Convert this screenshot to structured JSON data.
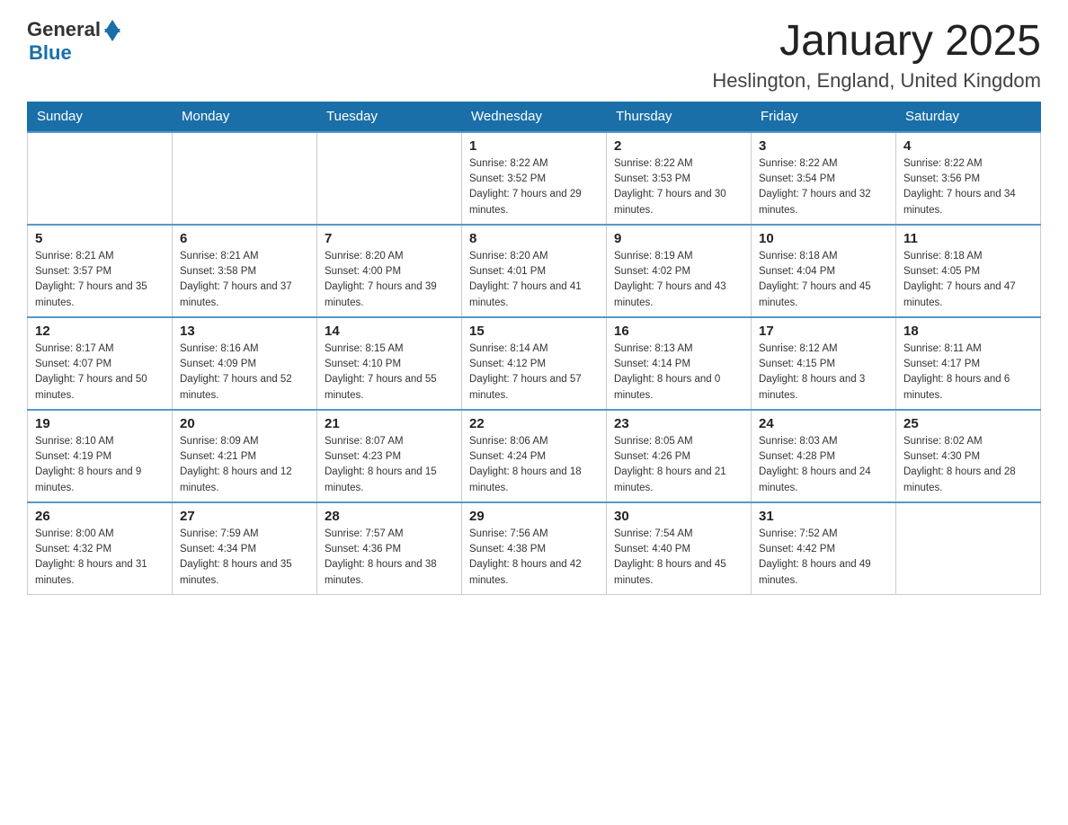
{
  "header": {
    "logo_general": "General",
    "logo_blue": "Blue",
    "month_title": "January 2025",
    "location": "Heslington, England, United Kingdom"
  },
  "days_of_week": [
    "Sunday",
    "Monday",
    "Tuesday",
    "Wednesday",
    "Thursday",
    "Friday",
    "Saturday"
  ],
  "weeks": [
    [
      {
        "day": "",
        "sunrise": "",
        "sunset": "",
        "daylight": ""
      },
      {
        "day": "",
        "sunrise": "",
        "sunset": "",
        "daylight": ""
      },
      {
        "day": "",
        "sunrise": "",
        "sunset": "",
        "daylight": ""
      },
      {
        "day": "1",
        "sunrise": "Sunrise: 8:22 AM",
        "sunset": "Sunset: 3:52 PM",
        "daylight": "Daylight: 7 hours and 29 minutes."
      },
      {
        "day": "2",
        "sunrise": "Sunrise: 8:22 AM",
        "sunset": "Sunset: 3:53 PM",
        "daylight": "Daylight: 7 hours and 30 minutes."
      },
      {
        "day": "3",
        "sunrise": "Sunrise: 8:22 AM",
        "sunset": "Sunset: 3:54 PM",
        "daylight": "Daylight: 7 hours and 32 minutes."
      },
      {
        "day": "4",
        "sunrise": "Sunrise: 8:22 AM",
        "sunset": "Sunset: 3:56 PM",
        "daylight": "Daylight: 7 hours and 34 minutes."
      }
    ],
    [
      {
        "day": "5",
        "sunrise": "Sunrise: 8:21 AM",
        "sunset": "Sunset: 3:57 PM",
        "daylight": "Daylight: 7 hours and 35 minutes."
      },
      {
        "day": "6",
        "sunrise": "Sunrise: 8:21 AM",
        "sunset": "Sunset: 3:58 PM",
        "daylight": "Daylight: 7 hours and 37 minutes."
      },
      {
        "day": "7",
        "sunrise": "Sunrise: 8:20 AM",
        "sunset": "Sunset: 4:00 PM",
        "daylight": "Daylight: 7 hours and 39 minutes."
      },
      {
        "day": "8",
        "sunrise": "Sunrise: 8:20 AM",
        "sunset": "Sunset: 4:01 PM",
        "daylight": "Daylight: 7 hours and 41 minutes."
      },
      {
        "day": "9",
        "sunrise": "Sunrise: 8:19 AM",
        "sunset": "Sunset: 4:02 PM",
        "daylight": "Daylight: 7 hours and 43 minutes."
      },
      {
        "day": "10",
        "sunrise": "Sunrise: 8:18 AM",
        "sunset": "Sunset: 4:04 PM",
        "daylight": "Daylight: 7 hours and 45 minutes."
      },
      {
        "day": "11",
        "sunrise": "Sunrise: 8:18 AM",
        "sunset": "Sunset: 4:05 PM",
        "daylight": "Daylight: 7 hours and 47 minutes."
      }
    ],
    [
      {
        "day": "12",
        "sunrise": "Sunrise: 8:17 AM",
        "sunset": "Sunset: 4:07 PM",
        "daylight": "Daylight: 7 hours and 50 minutes."
      },
      {
        "day": "13",
        "sunrise": "Sunrise: 8:16 AM",
        "sunset": "Sunset: 4:09 PM",
        "daylight": "Daylight: 7 hours and 52 minutes."
      },
      {
        "day": "14",
        "sunrise": "Sunrise: 8:15 AM",
        "sunset": "Sunset: 4:10 PM",
        "daylight": "Daylight: 7 hours and 55 minutes."
      },
      {
        "day": "15",
        "sunrise": "Sunrise: 8:14 AM",
        "sunset": "Sunset: 4:12 PM",
        "daylight": "Daylight: 7 hours and 57 minutes."
      },
      {
        "day": "16",
        "sunrise": "Sunrise: 8:13 AM",
        "sunset": "Sunset: 4:14 PM",
        "daylight": "Daylight: 8 hours and 0 minutes."
      },
      {
        "day": "17",
        "sunrise": "Sunrise: 8:12 AM",
        "sunset": "Sunset: 4:15 PM",
        "daylight": "Daylight: 8 hours and 3 minutes."
      },
      {
        "day": "18",
        "sunrise": "Sunrise: 8:11 AM",
        "sunset": "Sunset: 4:17 PM",
        "daylight": "Daylight: 8 hours and 6 minutes."
      }
    ],
    [
      {
        "day": "19",
        "sunrise": "Sunrise: 8:10 AM",
        "sunset": "Sunset: 4:19 PM",
        "daylight": "Daylight: 8 hours and 9 minutes."
      },
      {
        "day": "20",
        "sunrise": "Sunrise: 8:09 AM",
        "sunset": "Sunset: 4:21 PM",
        "daylight": "Daylight: 8 hours and 12 minutes."
      },
      {
        "day": "21",
        "sunrise": "Sunrise: 8:07 AM",
        "sunset": "Sunset: 4:23 PM",
        "daylight": "Daylight: 8 hours and 15 minutes."
      },
      {
        "day": "22",
        "sunrise": "Sunrise: 8:06 AM",
        "sunset": "Sunset: 4:24 PM",
        "daylight": "Daylight: 8 hours and 18 minutes."
      },
      {
        "day": "23",
        "sunrise": "Sunrise: 8:05 AM",
        "sunset": "Sunset: 4:26 PM",
        "daylight": "Daylight: 8 hours and 21 minutes."
      },
      {
        "day": "24",
        "sunrise": "Sunrise: 8:03 AM",
        "sunset": "Sunset: 4:28 PM",
        "daylight": "Daylight: 8 hours and 24 minutes."
      },
      {
        "day": "25",
        "sunrise": "Sunrise: 8:02 AM",
        "sunset": "Sunset: 4:30 PM",
        "daylight": "Daylight: 8 hours and 28 minutes."
      }
    ],
    [
      {
        "day": "26",
        "sunrise": "Sunrise: 8:00 AM",
        "sunset": "Sunset: 4:32 PM",
        "daylight": "Daylight: 8 hours and 31 minutes."
      },
      {
        "day": "27",
        "sunrise": "Sunrise: 7:59 AM",
        "sunset": "Sunset: 4:34 PM",
        "daylight": "Daylight: 8 hours and 35 minutes."
      },
      {
        "day": "28",
        "sunrise": "Sunrise: 7:57 AM",
        "sunset": "Sunset: 4:36 PM",
        "daylight": "Daylight: 8 hours and 38 minutes."
      },
      {
        "day": "29",
        "sunrise": "Sunrise: 7:56 AM",
        "sunset": "Sunset: 4:38 PM",
        "daylight": "Daylight: 8 hours and 42 minutes."
      },
      {
        "day": "30",
        "sunrise": "Sunrise: 7:54 AM",
        "sunset": "Sunset: 4:40 PM",
        "daylight": "Daylight: 8 hours and 45 minutes."
      },
      {
        "day": "31",
        "sunrise": "Sunrise: 7:52 AM",
        "sunset": "Sunset: 4:42 PM",
        "daylight": "Daylight: 8 hours and 49 minutes."
      },
      {
        "day": "",
        "sunrise": "",
        "sunset": "",
        "daylight": ""
      }
    ]
  ]
}
